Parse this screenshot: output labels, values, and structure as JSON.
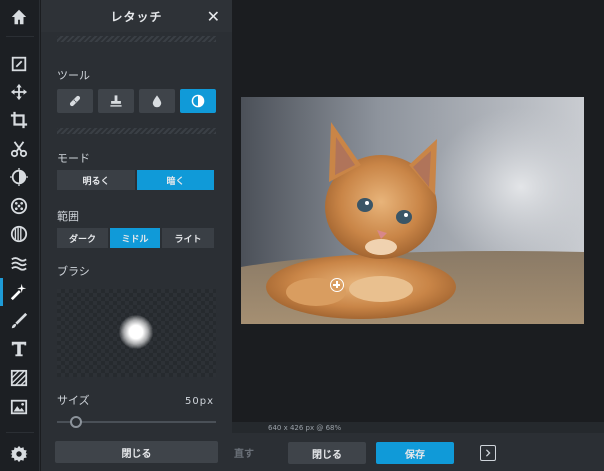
{
  "rail": {
    "items": [
      {
        "name": "home-icon"
      },
      {
        "name": "edit-icon"
      },
      {
        "name": "move-icon"
      },
      {
        "name": "crop-icon"
      },
      {
        "name": "cut-icon"
      },
      {
        "name": "adjust-icon"
      },
      {
        "name": "filter-icon"
      },
      {
        "name": "effects-icon"
      },
      {
        "name": "liquify-icon"
      },
      {
        "name": "retouch-icon"
      },
      {
        "name": "draw-icon"
      },
      {
        "name": "text-icon"
      },
      {
        "name": "texture-icon"
      },
      {
        "name": "image-icon"
      },
      {
        "name": "settings-icon"
      }
    ],
    "active": "retouch-icon"
  },
  "panel": {
    "title": "レタッチ",
    "close_label": "✕",
    "tool_label": "ツール",
    "tools": [
      {
        "name": "bandage-icon"
      },
      {
        "name": "stamp-icon"
      },
      {
        "name": "drop-icon"
      },
      {
        "name": "dodge-burn-icon",
        "active": true
      }
    ],
    "mode_label": "モード",
    "modes": [
      {
        "label": "明るく",
        "active": false
      },
      {
        "label": "暗く",
        "active": true
      }
    ],
    "range_label": "範囲",
    "ranges": [
      {
        "label": "ダーク",
        "active": false
      },
      {
        "label": "ミドル",
        "active": true
      },
      {
        "label": "ライト",
        "active": false
      }
    ],
    "brush_label": "ブラシ",
    "size_label": "サイズ",
    "size_value": "50px",
    "size_fraction": 0.12,
    "close_button": "閉じる"
  },
  "workspace": {
    "info": "640 x 426 px @ 68%"
  },
  "bottom": {
    "undo_label": "直す",
    "close_label": "閉じる",
    "save_label": "保存"
  },
  "colors": {
    "accent": "#109ad8",
    "panel_bg": "#2b2f34",
    "workspace_bg": "#1b1d20"
  }
}
